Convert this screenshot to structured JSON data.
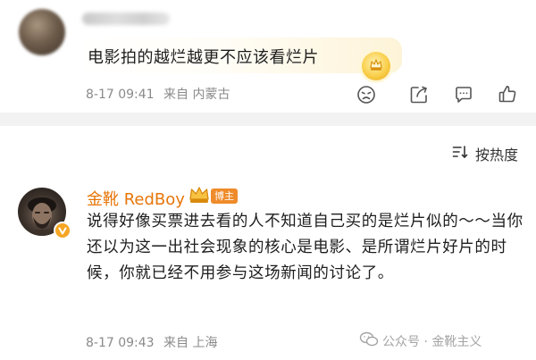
{
  "comment1": {
    "text": "电影拍的越烂越更不应该看烂片",
    "date": "8-17 09:41",
    "location": "来自 内蒙古"
  },
  "sort": {
    "label": "按热度"
  },
  "comment2": {
    "author": "金靴 RedBoy",
    "role_tag": "博主",
    "text": "说得好像买票进去看的人不知道自己买的是烂片似的～～当你还以为这一出社会现象的核心是电影、是所谓烂片好片的时候，你就已经不用参与这场新闻的讨论了。",
    "date": "8-17 09:43",
    "location": "来自 上海"
  },
  "watermark": {
    "text": "公众号 · 金靴主义"
  },
  "colors": {
    "author": "#e7760a",
    "role_tag_bg": "#ee8b2a",
    "meta_text": "#8a8a8a",
    "divider_band": "#f2f2f2"
  },
  "icons": {
    "actions": [
      "sad-face-icon",
      "share-icon",
      "comment-icon",
      "like-icon"
    ],
    "sort": "sort-icon",
    "badge": "emblem-badge-icon",
    "crown": "crown-icon",
    "verified": "verified-v-icon"
  }
}
